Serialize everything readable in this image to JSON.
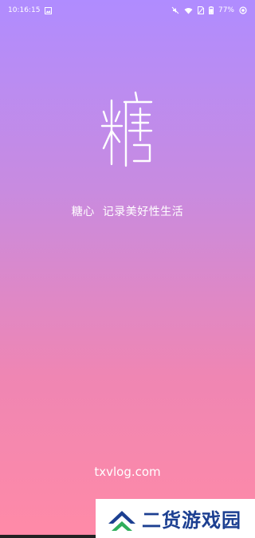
{
  "status_bar": {
    "time": "10:16:15",
    "battery": "77%",
    "icons": [
      "image-notification-icon",
      "mute-icon",
      "wifi-icon",
      "no-sim-icon",
      "battery-icon",
      "rotate-lock-icon"
    ]
  },
  "splash": {
    "logo_char": "糖",
    "tagline_left": "糖心",
    "tagline_right": "记录美好性生活",
    "url": "txvlog.com"
  },
  "watermark": {
    "text": "二货游戏园"
  },
  "colors": {
    "gradient_top": "#b08cff",
    "gradient_mid": "#c88be0",
    "gradient_bottom": "#ff8aa7",
    "watermark_blue": "#1c3f91"
  }
}
